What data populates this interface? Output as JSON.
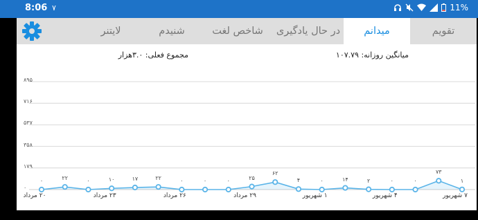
{
  "status": {
    "time": "8:06",
    "notification": "۷",
    "battery": "11%"
  },
  "tabs": [
    {
      "label": "تقویم",
      "active": false
    },
    {
      "label": "میدانم",
      "active": true
    },
    {
      "label": "در حال یادگیری",
      "active": false
    },
    {
      "label": "شاخص لغت",
      "active": false
    },
    {
      "label": "شنیدم",
      "active": false
    },
    {
      "label": "لایتنر",
      "active": false
    }
  ],
  "stats": {
    "daily_average": "میانگین روزانه: ۱۰۷.۷۹",
    "current_total": "مجموع فعلی: ۳.۰هزار"
  },
  "colors": {
    "accent": "#1a8ee0",
    "statusbar": "#1e73c8",
    "line": "#5ab4e8"
  },
  "chart_data": {
    "type": "line",
    "y_ticks": [
      "۸۹۵",
      "۷۱۶",
      "۵۳۷",
      "۳۵۸",
      "۱۷۹",
      "۰"
    ],
    "ylim": [
      0,
      895
    ],
    "x_tick_labels": [
      "۷ شهریور",
      "۴ شهریور",
      "۱ شهریور",
      "۲۹ مرداد",
      "۲۶ مرداد",
      "۲۳ مرداد",
      "۲۰ مرداد"
    ],
    "values": [
      1,
      73,
      0,
      0,
      2,
      14,
      0,
      4,
      62,
      25,
      0,
      0,
      0,
      22,
      17,
      10,
      0,
      22,
      0
    ],
    "value_labels": [
      "۱",
      "۷۳",
      "۰",
      "۰",
      "۲",
      "۱۴",
      "۰",
      "۴",
      "۶۲",
      "۲۵",
      "۰",
      "۰",
      "۰",
      "۲۲",
      "۱۷",
      "۱۰",
      "۰",
      "۲۲",
      "۰"
    ],
    "grid": true
  }
}
